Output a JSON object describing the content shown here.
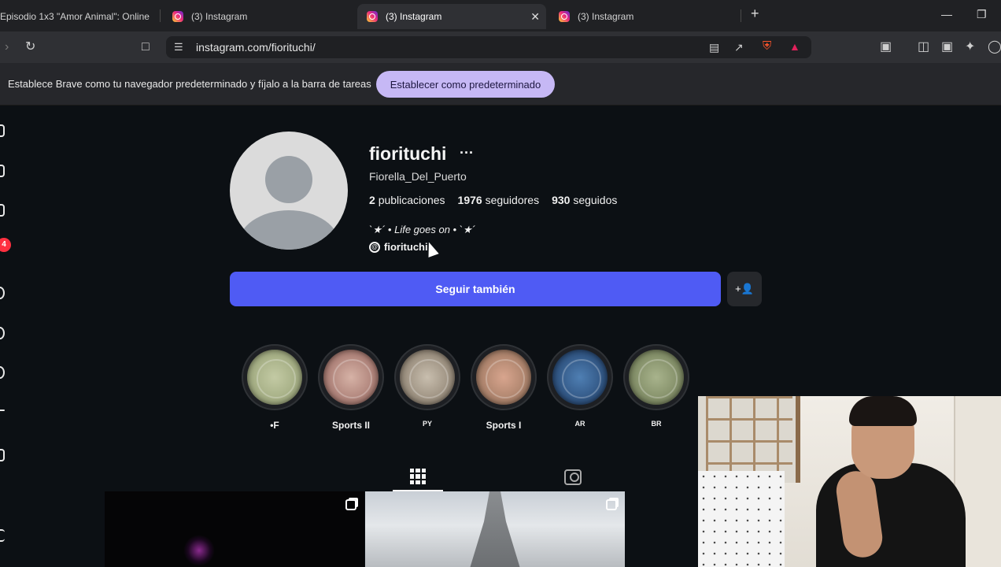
{
  "browser": {
    "tabs": [
      {
        "title": "Episodio 1x3 \"Amor Animal\": Online",
        "icon": "generic-favicon"
      },
      {
        "title": "(3) Instagram",
        "icon": "instagram-favicon"
      },
      {
        "title": "(3) Instagram",
        "icon": "instagram-favicon",
        "active": true
      },
      {
        "title": "(3) Instagram",
        "icon": "instagram-favicon"
      }
    ],
    "close_label": "✕",
    "new_tab_label": "+",
    "url": "instagram.com/fiorituchi/"
  },
  "infobar": {
    "message": "Establece Brave como tu navegador predeterminado y fíjalo a la barra de tareas",
    "button_label": "Establecer como predeterminado"
  },
  "nav": {
    "notification_count": "4"
  },
  "profile": {
    "username": "fiorituchi",
    "more_label": "···",
    "full_name": "Fiorella_Del_Puerto",
    "stats": {
      "posts_count": "2",
      "posts_label": "publicaciones",
      "followers_count": "1976",
      "followers_label": "seguidores",
      "following_count": "930",
      "following_label": "seguidos"
    },
    "bio": "`★´ • Life goes on • `★´",
    "threads_handle": "fiorituchi",
    "follow_button": "Seguir también",
    "suggest_button": "+👤"
  },
  "highlights": [
    {
      "label": "•F",
      "color": "#a9b38d"
    },
    {
      "label": "Sports II",
      "color": "#b88e8a"
    },
    {
      "label": "PY",
      "color": "#a79b8a"
    },
    {
      "label": "Sports I",
      "color": "#c29884"
    },
    {
      "label": "AR",
      "color": "#2f5b8c"
    },
    {
      "label": "BR",
      "color": "#8d9a72"
    }
  ],
  "colors": {
    "background": "#0c1014",
    "follow_button": "#4f5bf4",
    "infobar_button": "#c6b8f5",
    "badge": "#ff3040"
  }
}
